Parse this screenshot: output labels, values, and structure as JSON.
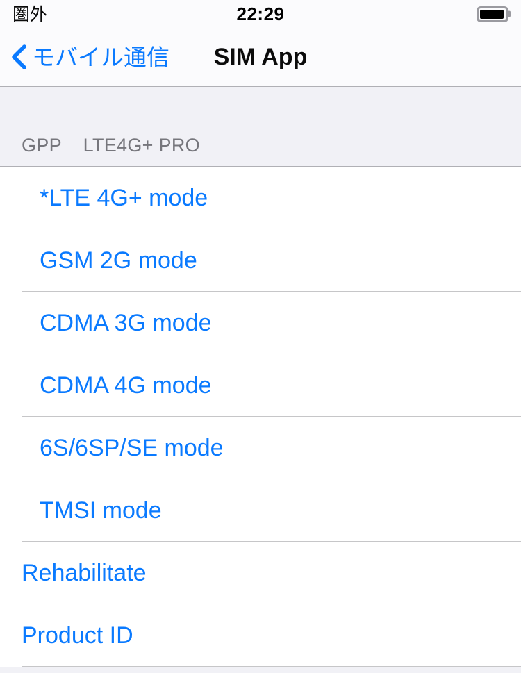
{
  "status_bar": {
    "carrier": "圏外",
    "time": "22:29",
    "battery_icon": "battery-full-icon",
    "battery_level_percent": 95
  },
  "nav_bar": {
    "back_icon": "chevron-left-icon",
    "back_label": "モバイル通信",
    "title": "SIM App"
  },
  "section": {
    "header": "GPP    LTE4G+ PRO"
  },
  "list": {
    "rows": [
      {
        "label": "*LTE 4G+ mode",
        "indent": "indent",
        "selected": true
      },
      {
        "label": "GSM 2G mode",
        "indent": "indent",
        "selected": false
      },
      {
        "label": "CDMA 3G mode",
        "indent": "indent",
        "selected": false
      },
      {
        "label": "CDMA 4G mode",
        "indent": "indent",
        "selected": false
      },
      {
        "label": "6S/6SP/SE mode",
        "indent": "indent",
        "selected": false
      },
      {
        "label": "TMSI mode",
        "indent": "indent",
        "selected": false
      },
      {
        "label": "Rehabilitate",
        "indent": "flush",
        "selected": false
      },
      {
        "label": "Product ID",
        "indent": "flush",
        "selected": false
      }
    ]
  },
  "colors": {
    "accent_blue": "#0a7aff",
    "bar_background": "#fbfbfd",
    "group_background": "#f1f1f6",
    "separator": "#c6c6c8",
    "header_text": "#76767c",
    "title_text": "#0b0b0b"
  }
}
